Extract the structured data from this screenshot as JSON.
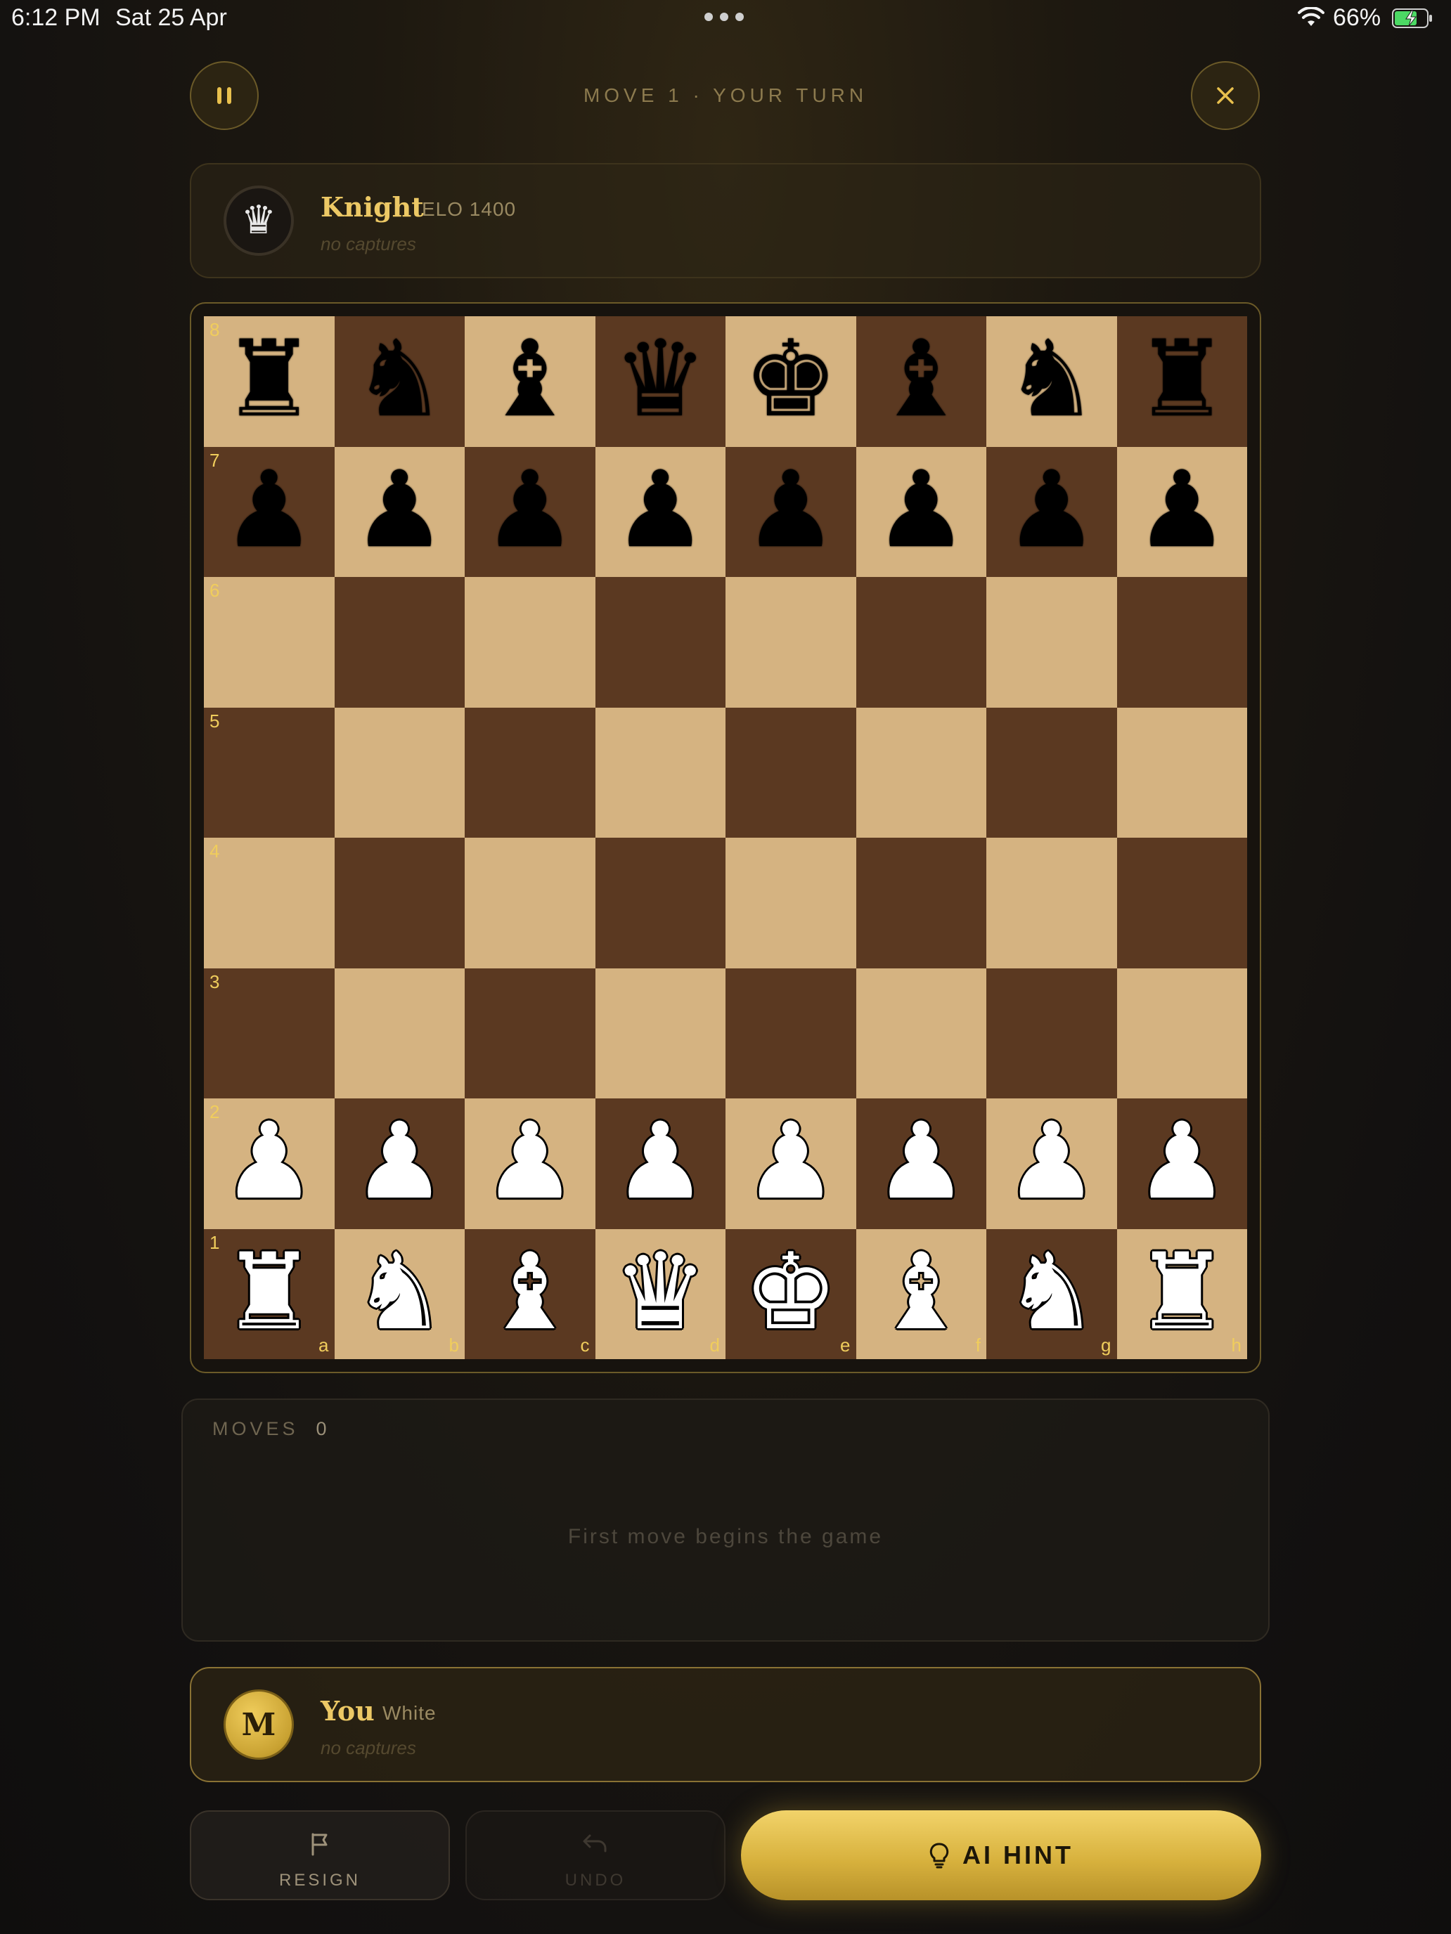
{
  "status_bar": {
    "time": "6:12 PM",
    "date": "Sat 25 Apr",
    "battery": "66%"
  },
  "header": {
    "move_status": "MOVE 1 · YOUR TURN"
  },
  "opponent": {
    "name": "Knight",
    "rating": "ELO 1400",
    "captures": "no captures"
  },
  "player": {
    "avatar_letter": "M",
    "name": "You",
    "side": "White",
    "captures": "no captures"
  },
  "board": {
    "ranks": [
      "8",
      "7",
      "6",
      "5",
      "4",
      "3",
      "2",
      "1"
    ],
    "files": [
      "a",
      "b",
      "c",
      "d",
      "e",
      "f",
      "g",
      "h"
    ],
    "position": [
      [
        "br",
        "bn",
        "bb",
        "bq",
        "bk",
        "bb",
        "bn",
        "br"
      ],
      [
        "bp",
        "bp",
        "bp",
        "bp",
        "bp",
        "bp",
        "bp",
        "bp"
      ],
      [
        "",
        "",
        "",
        "",
        "",
        "",
        "",
        ""
      ],
      [
        "",
        "",
        "",
        "",
        "",
        "",
        "",
        ""
      ],
      [
        "",
        "",
        "",
        "",
        "",
        "",
        "",
        ""
      ],
      [
        "",
        "",
        "",
        "",
        "",
        "",
        "",
        ""
      ],
      [
        "wp",
        "wp",
        "wp",
        "wp",
        "wp",
        "wp",
        "wp",
        "wp"
      ],
      [
        "wr",
        "wn",
        "wb",
        "wq",
        "wk",
        "wb",
        "wn",
        "wr"
      ]
    ],
    "light_color": "#d5b381",
    "dark_color": "#5b3921"
  },
  "moves": {
    "label": "MOVES",
    "count": "0",
    "empty_text": "First move begins the game"
  },
  "actions": {
    "resign": "RESIGN",
    "undo": "UNDO",
    "hint": "AI HINT"
  },
  "colors": {
    "accent_gold": "#e8c04d",
    "background": "#15120e"
  }
}
